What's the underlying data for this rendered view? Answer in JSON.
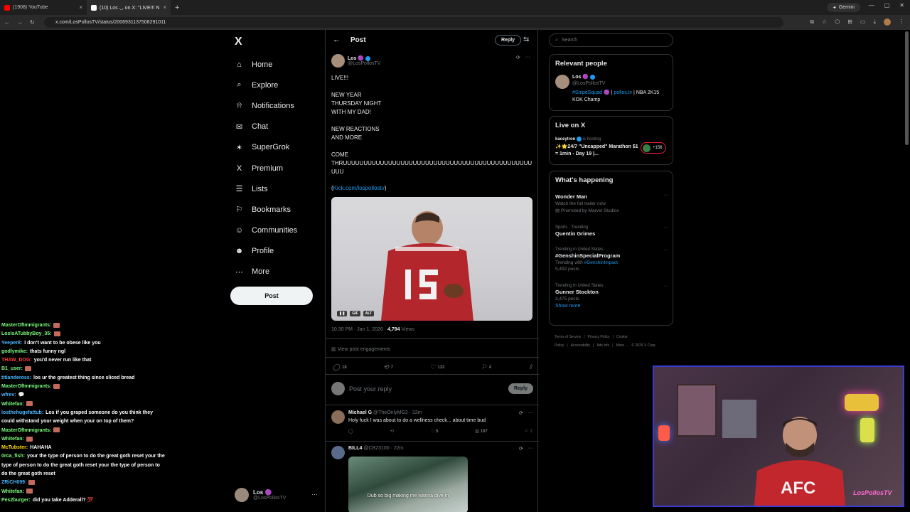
{
  "browser": {
    "tabs": [
      {
        "title": "(1908) YouTube",
        "color": "#ff0000"
      },
      {
        "title": "(10) Los ◡ on X: \"LIVE!!! NEW",
        "color": "#ffffff"
      }
    ],
    "new_tab": "+",
    "gemini_label": "Gemini",
    "url": "x.com/LosPollosTV/status/2006931137508291011"
  },
  "x_sidebar": {
    "logo": "X",
    "items": [
      {
        "label": "Home",
        "icon": "⌂"
      },
      {
        "label": "Explore",
        "icon": "⌕"
      },
      {
        "label": "Notifications",
        "icon": "⍾",
        "badge": "10"
      },
      {
        "label": "Chat",
        "icon": "✉"
      },
      {
        "label": "SuperGrok",
        "icon": "✶"
      },
      {
        "label": "Premium",
        "icon": "X"
      },
      {
        "label": "Lists",
        "icon": "☰"
      },
      {
        "label": "Bookmarks",
        "icon": "⚐"
      },
      {
        "label": "Communities",
        "icon": "☺"
      },
      {
        "label": "Profile",
        "icon": "☻"
      },
      {
        "label": "More",
        "icon": "⋯"
      }
    ],
    "post_button": "Post",
    "account": {
      "name": "Los 🟣",
      "handle": "@LosPollosTV",
      "more": "···"
    }
  },
  "main": {
    "header_title": "Post",
    "reply_button": "Reply",
    "author": {
      "name": "Los 🟣",
      "handle": "@LosPollosTV"
    },
    "text": "LIVE!!!\n\nNEW YEAR\nTHURSDAY NIGHT\nWITH MY DAD!\n\nNEW REACTIONS\nAND MORE\n\nCOME\nTHRUUUUUUUUUUUUUUUUUUUUUUUUUUUUUUUUUUUUUUUUUUUUUUUUU",
    "link_open": "(",
    "link": "Kick.com/lospollostv",
    "link_close": ")",
    "media_controls": {
      "pause": "❚❚",
      "gif": "GIF",
      "alt": "ALT"
    },
    "meta_time": "10:30 PM · Jan 1, 2026 · ",
    "meta_views": "4,794",
    "meta_views_label": " Views",
    "view_engagements": "View post engagements",
    "stats": {
      "replies": "18",
      "reposts": "7",
      "likes": "133",
      "bookmarks": "4"
    },
    "composer_placeholder": "Post your reply",
    "composer_button": "Reply",
    "replies": [
      {
        "name": "Michael G",
        "handle": "@TheOnlyMG2 · 22m",
        "text": "Holy fuck I was about to do a wellness check... about time bud",
        "likes": "5",
        "views": "197",
        "avatar_color": "#8a6e5a"
      },
      {
        "name": "BILL4",
        "handle": "@CB23100 · 22m",
        "media_caption": "Dub so big making me wanna dive in",
        "avatar_color": "#5a6a8a"
      }
    ]
  },
  "right": {
    "search_placeholder": "Search",
    "relevant_people": {
      "title": "Relevant people",
      "name": "Los 🟣",
      "handle": "@LosPollosTV",
      "bio_link1": "#SnipeSquad 🟣",
      "bio_sep": " | ",
      "bio_link2": "pollos.tv",
      "bio_rest": " | NBA 2K15 KOK Champ"
    },
    "live_on_x": {
      "title": "Live on X",
      "host": "kaceytron",
      "host_suffix": " is hosting",
      "stream_title": "✨🌟24/7 \"Uncapped\" Marathon $1 = 1min - Day 19 |...",
      "count": "+156"
    },
    "whats_happening": {
      "title": "What's happening",
      "trends": [
        {
          "context": "",
          "name": "Wonder Man",
          "sub": "Watch the full trailer now",
          "sub2": "▤ Promoted by Marvel Studios"
        },
        {
          "context": "Sports · Trending",
          "name": "Quentin Grimes",
          "sub": "",
          "sub2": ""
        },
        {
          "context": "Trending in United States",
          "name": "#GenshinSpecialProgram",
          "sub": "Trending with ",
          "sub_link": "#GenshinImpact",
          "sub2": "5,492 posts"
        },
        {
          "context": "Trending in United States",
          "name": "Gunner Stockton",
          "sub": "3,475 posts",
          "sub2": ""
        }
      ],
      "show_more": "Show more"
    },
    "footer": [
      "Terms of Service",
      "|",
      "Privacy Policy",
      "|",
      "Cookie Policy",
      "|",
      "Accessibility",
      "|",
      "Ads info",
      "|",
      "More ···",
      "© 2026 X Corp."
    ]
  },
  "chat": [
    {
      "user": "MasterOfImmigrants:",
      "color": "#7cfc7c",
      "text": "",
      "emote": true
    },
    {
      "user": "LosIsATubbyBoy_35:",
      "color": "#7cfc7c",
      "text": "",
      "emote": true
    },
    {
      "user": "Yeeper8:",
      "color": "#4ab8ff",
      "text": "I don't want to be obese like you",
      "emote": false
    },
    {
      "user": "godlymike:",
      "color": "#7cfc7c",
      "text": "thats funny ngl",
      "emote": false
    },
    {
      "user": "THAW_DOG:",
      "color": "#ff3b3b",
      "text": "you'd never run like that",
      "emote": false
    },
    {
      "user": "B1_user:",
      "color": "#7cfc7c",
      "text": "",
      "emote": true
    },
    {
      "user": "titiandeross:",
      "color": "#4ab8ff",
      "text": "los ur the greatest thing since sliced bread",
      "emote": false
    },
    {
      "user": "MasterOfImmigrants:",
      "color": "#7cfc7c",
      "text": "",
      "emote": true
    },
    {
      "user": "wfrev:",
      "color": "#4ab8ff",
      "text": "💬",
      "emote": false
    },
    {
      "user": "Whitefan:",
      "color": "#7cfc7c",
      "text": "",
      "emote": true
    },
    {
      "user": "losthehugefattub:",
      "color": "#4ab8ff",
      "text": "Los if you graped someone do you think they could withstand your weight when your on top of them?",
      "emote": false
    },
    {
      "user": "MasterOfImmigrants:",
      "color": "#7cfc7c",
      "text": "",
      "emote": true
    },
    {
      "user": "Whitefan:",
      "color": "#7cfc7c",
      "text": "",
      "emote": true
    },
    {
      "user": "McTubster:",
      "color": "#ffd700",
      "text": "HAHAHA",
      "emote": false
    },
    {
      "user": "0rca_fish:",
      "color": "#7cfc7c",
      "text": "your the type of person to do the great goth reset your the type of person to do the great goth reset your the type of person to do the great goth reset",
      "emote": false
    },
    {
      "user": "ZRiCH099:",
      "color": "#4ab8ff",
      "text": "",
      "emote": true
    },
    {
      "user": "Whitefan:",
      "color": "#7cfc7c",
      "text": "",
      "emote": true
    },
    {
      "user": "Pes2burger:",
      "color": "#7cfc7c",
      "text": "did you take Adderall? 💯",
      "emote": false
    }
  ],
  "webcam": {
    "signature": "LosPollosTV"
  }
}
